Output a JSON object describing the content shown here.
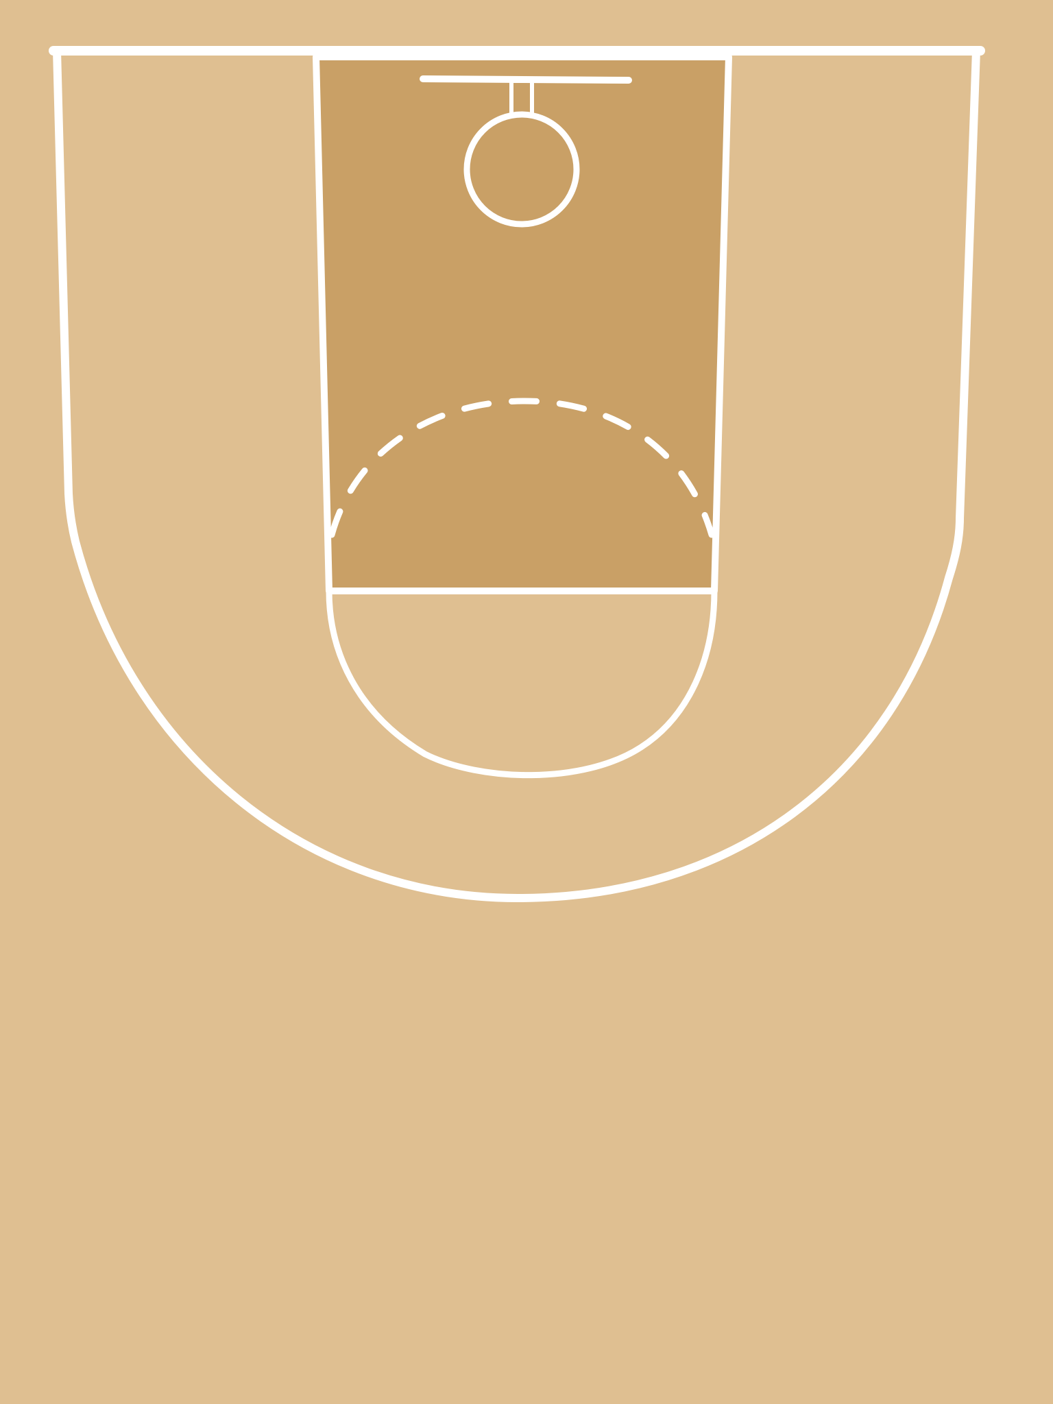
{
  "diagram": {
    "kind": "basketball-half-court",
    "colors": {
      "floor": "#DFBF91",
      "paint": "#C9A066",
      "lines": "#FFFFFF"
    },
    "elements": [
      "boundary-lines",
      "free-throw-lane",
      "free-throw-circle",
      "three-point-line",
      "backboard",
      "rim"
    ]
  }
}
